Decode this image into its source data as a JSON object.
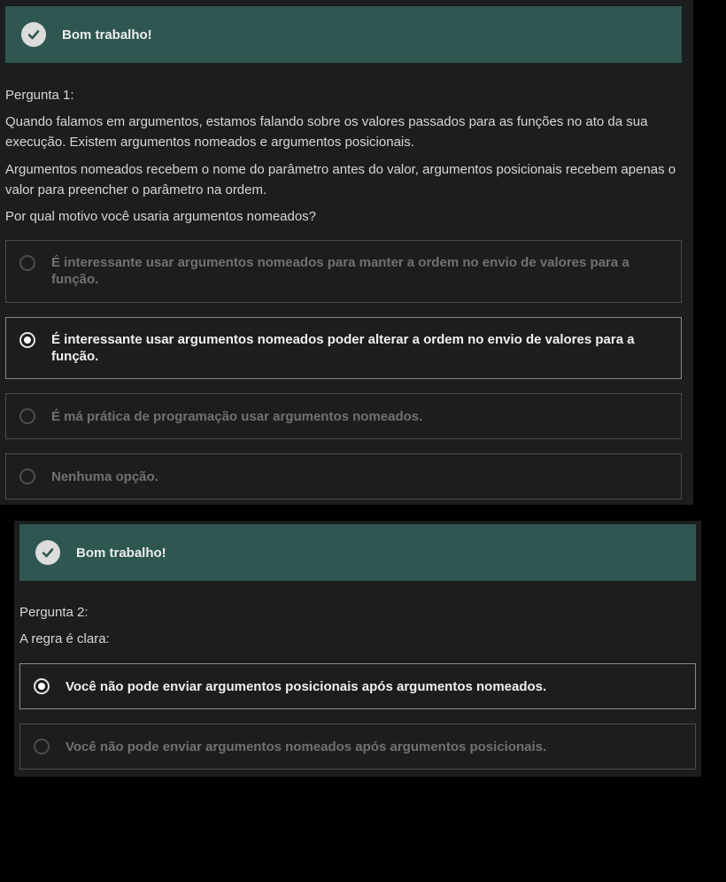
{
  "card1": {
    "banner_text": "Bom trabalho!",
    "question_label": "Pergunta 1:",
    "paragraphs": [
      "Quando falamos em argumentos, estamos falando sobre os valores passados para as funções no ato da sua execução. Existem argumentos nomeados e argumentos posicionais.",
      "Argumentos nomeados recebem o nome do parâmetro antes do valor, argumentos posicionais recebem apenas o valor para preencher o parâmetro na ordem.",
      "Por qual motivo você usaria argumentos nomeados?"
    ],
    "options": [
      {
        "label": "É interessante usar argumentos nomeados para manter a ordem no envio de valores para a função.",
        "selected": false
      },
      {
        "label": "É interessante usar argumentos nomeados poder alterar a ordem no envio de valores para a função.",
        "selected": true
      },
      {
        "label": "É má prática de programação usar argumentos nomeados.",
        "selected": false
      },
      {
        "label": "Nenhuma opção.",
        "selected": false
      }
    ]
  },
  "card2": {
    "banner_text": "Bom trabalho!",
    "question_label": "Pergunta 2:",
    "paragraphs": [
      "A regra é clara:"
    ],
    "options": [
      {
        "label": "Você não pode enviar argumentos posicionais após argumentos nomeados.",
        "selected": true
      },
      {
        "label": "Você não pode enviar argumentos nomeados após argumentos posicionais.",
        "selected": false
      }
    ]
  },
  "icons": {
    "banner_icon": "check-circle-icon",
    "radio_icon": "radio-button-icon"
  },
  "colors": {
    "background": "#000000",
    "card_background": "#1b1d1f",
    "success_banner": "#2d5750",
    "selected_border": "#8b8c80",
    "unselected_text": "#6f7173"
  }
}
